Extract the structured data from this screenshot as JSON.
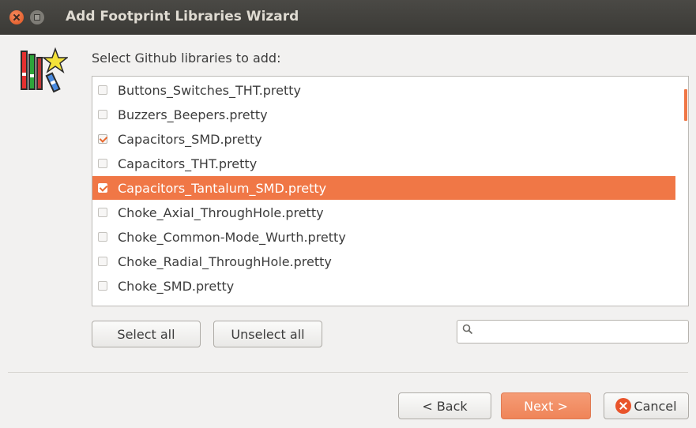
{
  "window": {
    "title": "Add Footprint Libraries Wizard"
  },
  "main": {
    "prompt": "Select Github libraries to add:",
    "libraries": [
      {
        "label": "Buttons_Switches_THT.pretty",
        "checked": false,
        "selected": false
      },
      {
        "label": "Buzzers_Beepers.pretty",
        "checked": false,
        "selected": false
      },
      {
        "label": "Capacitors_SMD.pretty",
        "checked": true,
        "selected": false
      },
      {
        "label": "Capacitors_THT.pretty",
        "checked": false,
        "selected": false
      },
      {
        "label": "Capacitors_Tantalum_SMD.pretty",
        "checked": true,
        "selected": true
      },
      {
        "label": "Choke_Axial_ThroughHole.pretty",
        "checked": false,
        "selected": false
      },
      {
        "label": "Choke_Common-Mode_Wurth.pretty",
        "checked": false,
        "selected": false
      },
      {
        "label": "Choke_Radial_ThroughHole.pretty",
        "checked": false,
        "selected": false
      },
      {
        "label": "Choke_SMD.pretty",
        "checked": false,
        "selected": false
      }
    ],
    "select_all_label": "Select all",
    "unselect_all_label": "Unselect all",
    "search": {
      "value": "",
      "icon": "search-icon"
    }
  },
  "footer": {
    "back_label": "< Back",
    "next_label": "Next >",
    "cancel_label": "Cancel",
    "cancel_icon": "cancel-icon"
  },
  "colors": {
    "accent": "#f07746",
    "titlebar": "#3b3a36",
    "window_bg": "#f2f1f0"
  }
}
